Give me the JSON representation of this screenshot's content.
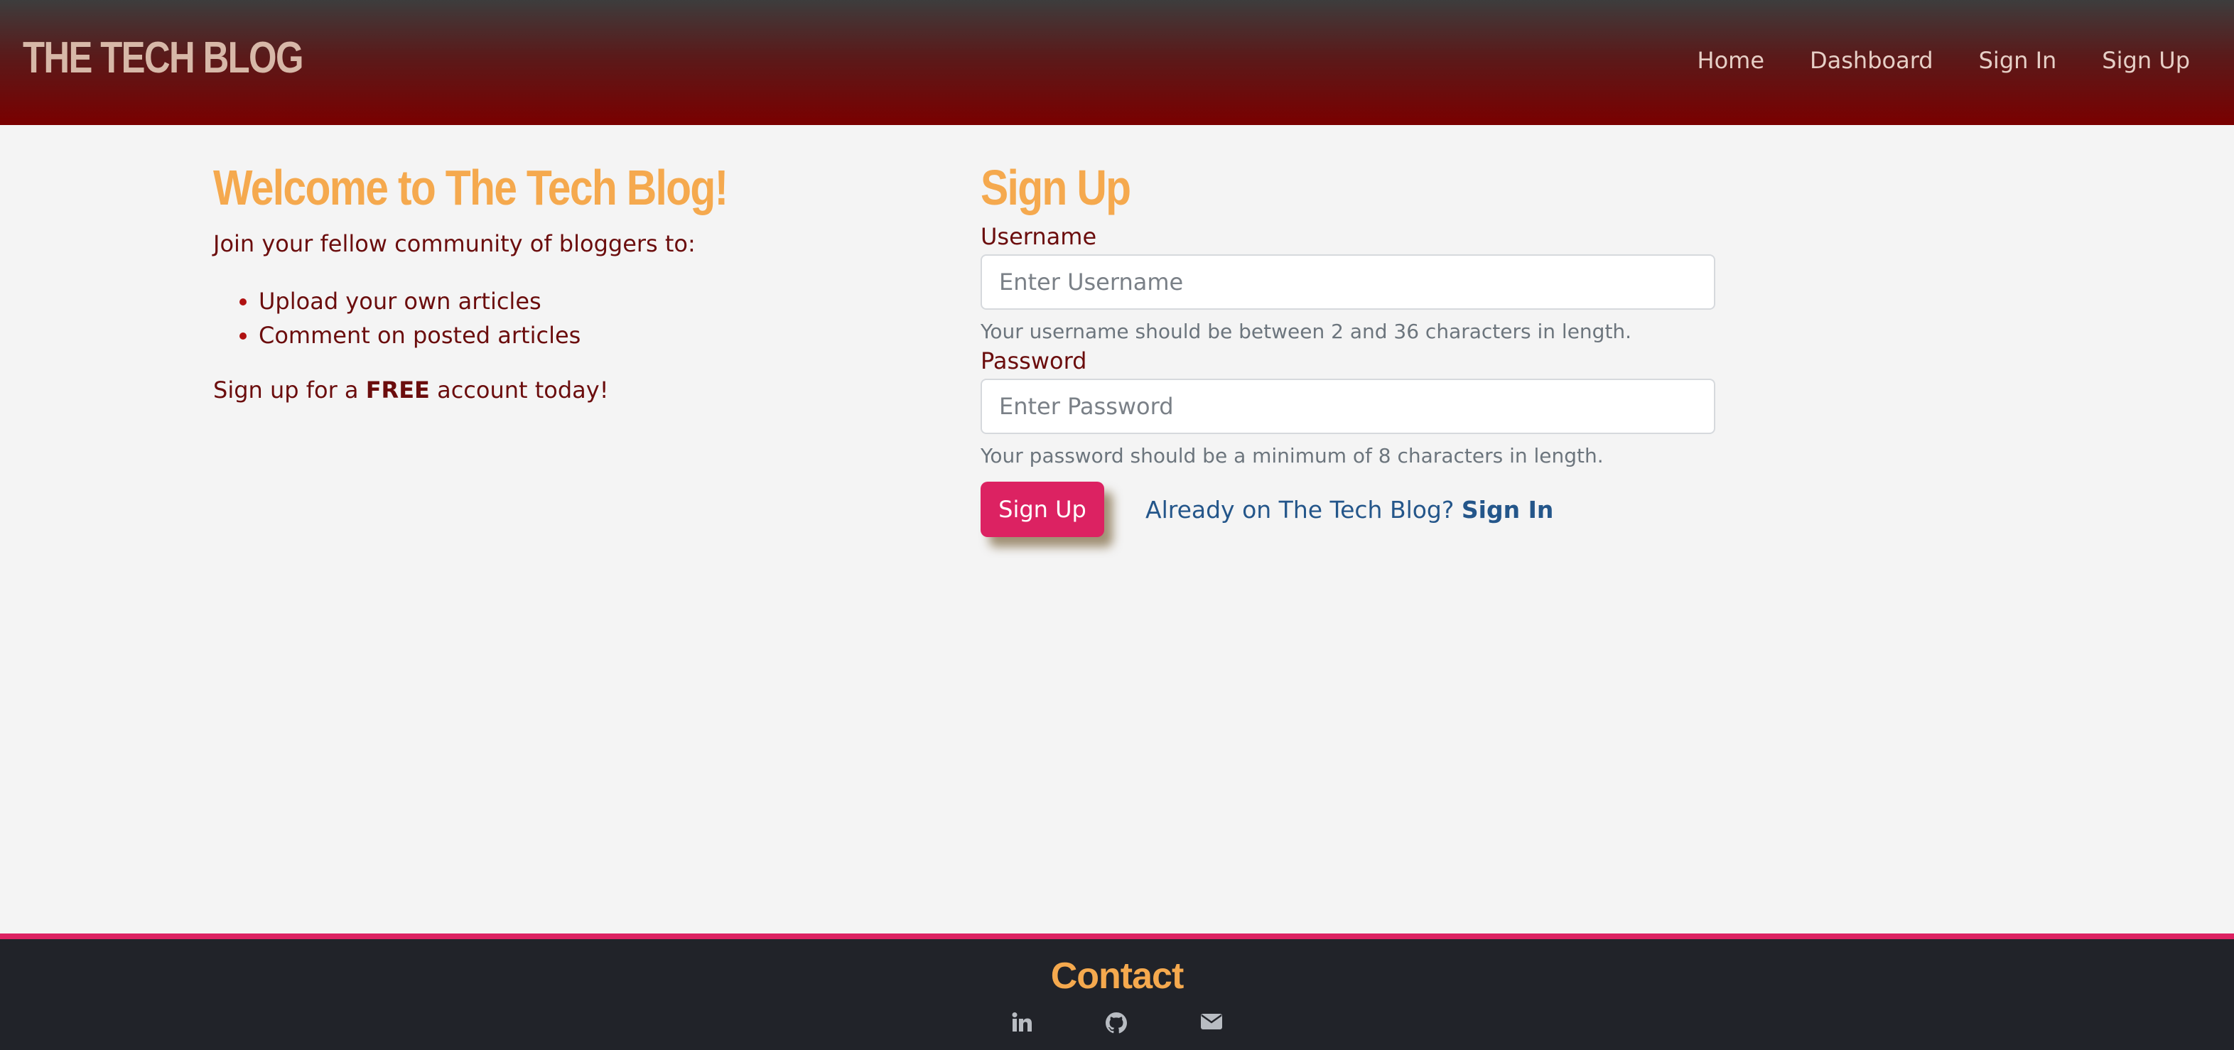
{
  "header": {
    "brand": "THE TECH BLOG",
    "nav": [
      "Home",
      "Dashboard",
      "Sign In",
      "Sign Up"
    ]
  },
  "welcome": {
    "title": "Welcome to The Tech Blog!",
    "intro": "Join your fellow community of bloggers to:",
    "perks": [
      "Upload your own articles",
      "Comment on posted articles"
    ],
    "cta_before": "Sign up for a ",
    "cta_bold": "FREE",
    "cta_after": " account today!"
  },
  "signup": {
    "title": "Sign Up",
    "username_label": "Username",
    "username_placeholder": "Enter Username",
    "username_help": "Your username should be between 2 and 36 characters in length.",
    "password_label": "Password",
    "password_placeholder": "Enter Password",
    "password_help": "Your password should be a minimum of 8 characters in length.",
    "submit_label": "Sign Up",
    "signin_prompt": "Already on The Tech Blog? ",
    "signin_link": "Sign In"
  },
  "footer": {
    "title": "Contact",
    "icons": [
      "linkedin-icon",
      "github-icon",
      "envelope-icon"
    ]
  },
  "colors": {
    "accent": "#f5a94e",
    "text_dark_red": "#6b0d0d",
    "button": "#dc2262",
    "link": "#24568a",
    "footer_bg": "#212329"
  }
}
